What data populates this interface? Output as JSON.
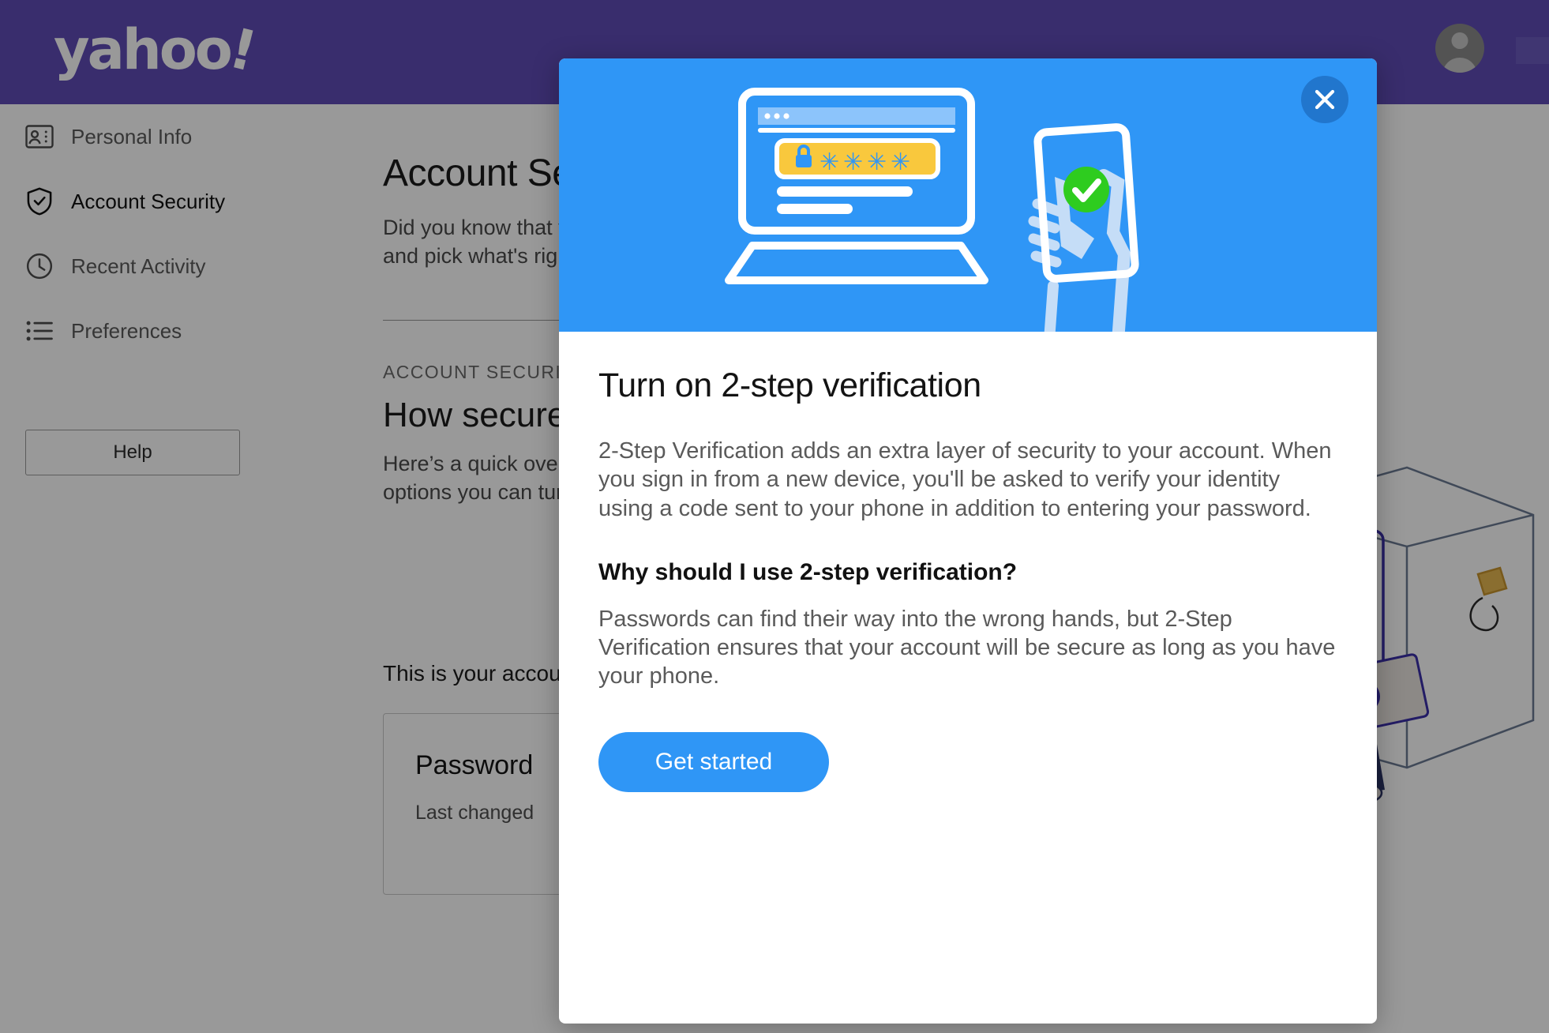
{
  "brand": {
    "name": "yahoo",
    "mark": "!"
  },
  "topbar": {
    "avatar_icon": "user-avatar-icon"
  },
  "sidebar": {
    "items": [
      {
        "label": "Personal Info",
        "icon": "contact-card-icon",
        "active": false
      },
      {
        "label": "Account Security",
        "icon": "shield-check-icon",
        "active": true
      },
      {
        "label": "Recent Activity",
        "icon": "clock-icon",
        "active": false
      },
      {
        "label": "Preferences",
        "icon": "list-icon",
        "active": false
      }
    ],
    "help_label": "Help"
  },
  "main": {
    "title": "Account Security",
    "lead": "Did you know that you can take steps to make your account more secure? Take a look and pick what's right for you.",
    "eyebrow": "ACCOUNT SECURITY",
    "subtitle": "How secure is your account?",
    "paragraph": "Here’s a quick overview of the settings that protect your account, as well the options you can turn on for extra security.",
    "subnote": "This is your account security checklist",
    "card": {
      "title": "Password",
      "subtitle": "Last changed"
    }
  },
  "modal": {
    "title": "Turn on 2-step verification",
    "paragraph": "2-Step Verification adds an extra layer of security to your account. When you sign in from a new device, you'll be asked to verify your identity using a code sent to your phone in addition to entering your password.",
    "question": "Why should I use 2-step verification?",
    "answer": "Passwords can find their way into the wrong hands, but 2-Step Verification ensures that your account will be secure as long as you have your phone.",
    "cta_label": "Get started",
    "close_icon": "close-icon",
    "hero": {
      "illustration": "laptop-password-phone-illustration",
      "password_mask": "****",
      "lock_icon": "lock-icon",
      "check_icon": "check-circle-icon"
    }
  },
  "colors": {
    "brand_purple": "#5f4bb6",
    "accent_blue": "#2f96f6",
    "close_blue": "#2176cd",
    "password_yellow": "#f9c83d",
    "success_green": "#2ecc1f",
    "overlay": "rgba(0,0,0,0.40)"
  }
}
